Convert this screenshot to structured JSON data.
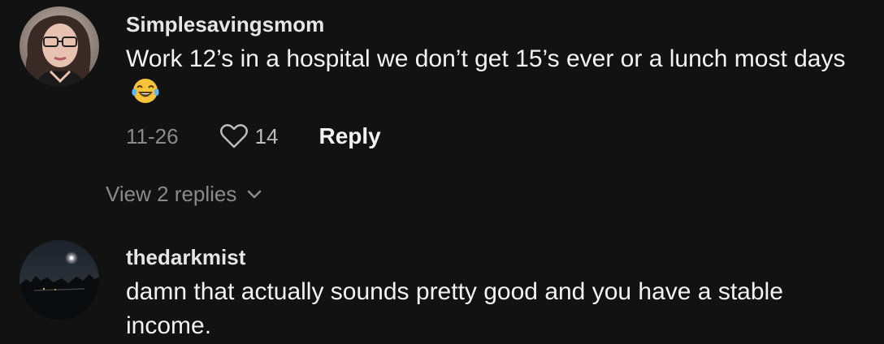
{
  "comments": [
    {
      "username": "Simplesavingsmom",
      "text": "Work 12’s in a hospital we don’t get 15’s ever or a lunch most days",
      "emoji": "face-with-tears-of-joy",
      "date": "11-26",
      "likes": "14",
      "reply_label": "Reply",
      "view_replies_label": "View 2 replies"
    },
    {
      "username": "thedarkmist",
      "text": "damn that actually sounds pretty good and you have a stable income."
    }
  ],
  "icons": {
    "like": "heart-outline-icon",
    "expand": "chevron-down-icon"
  },
  "colors": {
    "background": "#121212",
    "primary_text": "#f2f2f2",
    "secondary_text": "#8a8a8a"
  }
}
